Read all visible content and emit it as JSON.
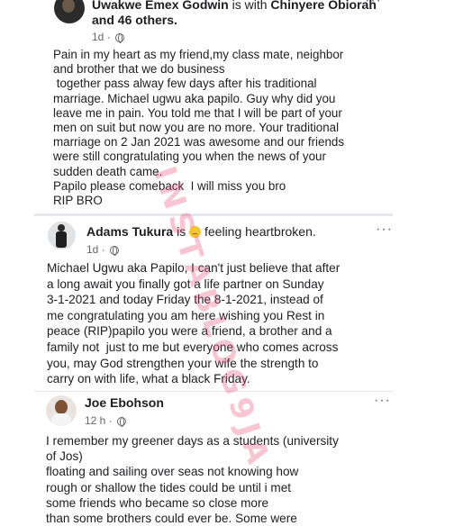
{
  "posts": [
    {
      "author": "Uwakwe Emex Godwin",
      "connector": " is with ",
      "tagged": "Chinyere Obiorah",
      "tagged_suffix": " and 46 others.",
      "time": "1d ·",
      "menu_label": "···",
      "body": "Pain in my heart as my friend,my class mate, neighbor\nand brother that we do business\n together pass alway few days after his traditional\nmarriage. Michael ugwu aka papilo. Guy why did you\nleave me in pain. You told me that I will be part of your\nmen on suit but now you are no more. Your traditional\nmarriage on 2 Jan 2021 was awesome and our friends\nwere still congratulating you when the news of your\nsudden death came.\nPapilo please comeback  I will miss you bro\nRIP BRO"
    },
    {
      "author": "Adams Tukura",
      "connector": " is ",
      "feeling": " feeling heartbroken.",
      "feeling_icon": "sad-face-emoji",
      "time": "1d ·",
      "menu_label": "···",
      "body": "Michael Ugwu aka Papilo, I can't just believe that after\na long await you finally got a life partner on Sunday\n3-1-2021 and today Friday the 8-1-2021, instead of\nme congratulating you am here wishing you Rest in\npeace (RIP)papilo you were a friend, a brother and a\nfamily not  just to me but everyone who comes across\nyou, may God strengthen your wife the strength to\ncarry on with life, what a black Friday."
    },
    {
      "author": "Joe Ebohson",
      "time": "12 h ·",
      "menu_label": "···",
      "body": "I remember my greener days as a students (university\nof Jos)\nfloating and sailing over seas not knowing how\nrough or shallow the tides could be until i met\nsome friends who became so close more\nthan some brothers could ever be. Some were"
    }
  ],
  "watermark": "INSTABLOG9JA",
  "colors": {
    "text": "#1c1e21",
    "meta": "#65676b",
    "watermark": "#eb5078",
    "separator": "#e4e6eb"
  }
}
